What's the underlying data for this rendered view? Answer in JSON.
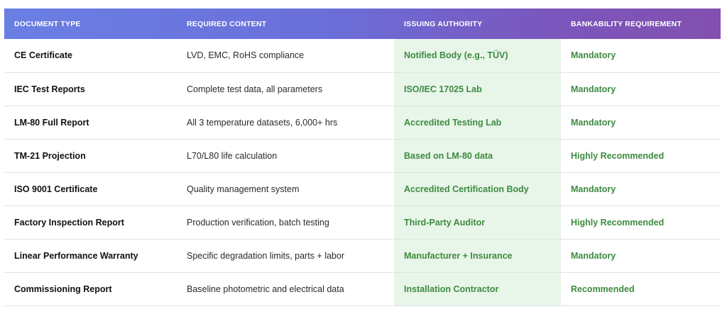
{
  "table": {
    "headers": [
      "DOCUMENT TYPE",
      "REQUIRED CONTENT",
      "ISSUING AUTHORITY",
      "BANKABILITY REQUIREMENT"
    ],
    "rows": [
      {
        "doc": "CE Certificate",
        "content": "LVD, EMC, RoHS compliance",
        "authority": "Notified Body (e.g., TÜV)",
        "bank": "Mandatory"
      },
      {
        "doc": "IEC Test Reports",
        "content": "Complete test data, all parameters",
        "authority": "ISO/IEC 17025 Lab",
        "bank": "Mandatory"
      },
      {
        "doc": "LM-80 Full Report",
        "content": "All 3 temperature datasets, 6,000+ hrs",
        "authority": "Accredited Testing Lab",
        "bank": "Mandatory"
      },
      {
        "doc": "TM-21 Projection",
        "content": "L70/L80 life calculation",
        "authority": "Based on LM-80 data",
        "bank": "Highly Recommended"
      },
      {
        "doc": "ISO 9001 Certificate",
        "content": "Quality management system",
        "authority": "Accredited Certification Body",
        "bank": "Mandatory"
      },
      {
        "doc": "Factory Inspection Report",
        "content": "Production verification, batch testing",
        "authority": "Third-Party Auditor",
        "bank": "Highly Recommended"
      },
      {
        "doc": "Linear Performance Warranty",
        "content": "Specific degradation limits, parts + labor",
        "authority": "Manufacturer + Insurance",
        "bank": "Mandatory"
      },
      {
        "doc": "Commissioning Report",
        "content": "Baseline photometric and electrical data",
        "authority": "Installation Contractor",
        "bank": "Recommended"
      }
    ]
  },
  "colors": {
    "header_gradient_start": "#6a7fe4",
    "header_gradient_end": "#8350b0",
    "authority_bg": "#e8f5e9",
    "accent_green": "#3d8b40"
  }
}
